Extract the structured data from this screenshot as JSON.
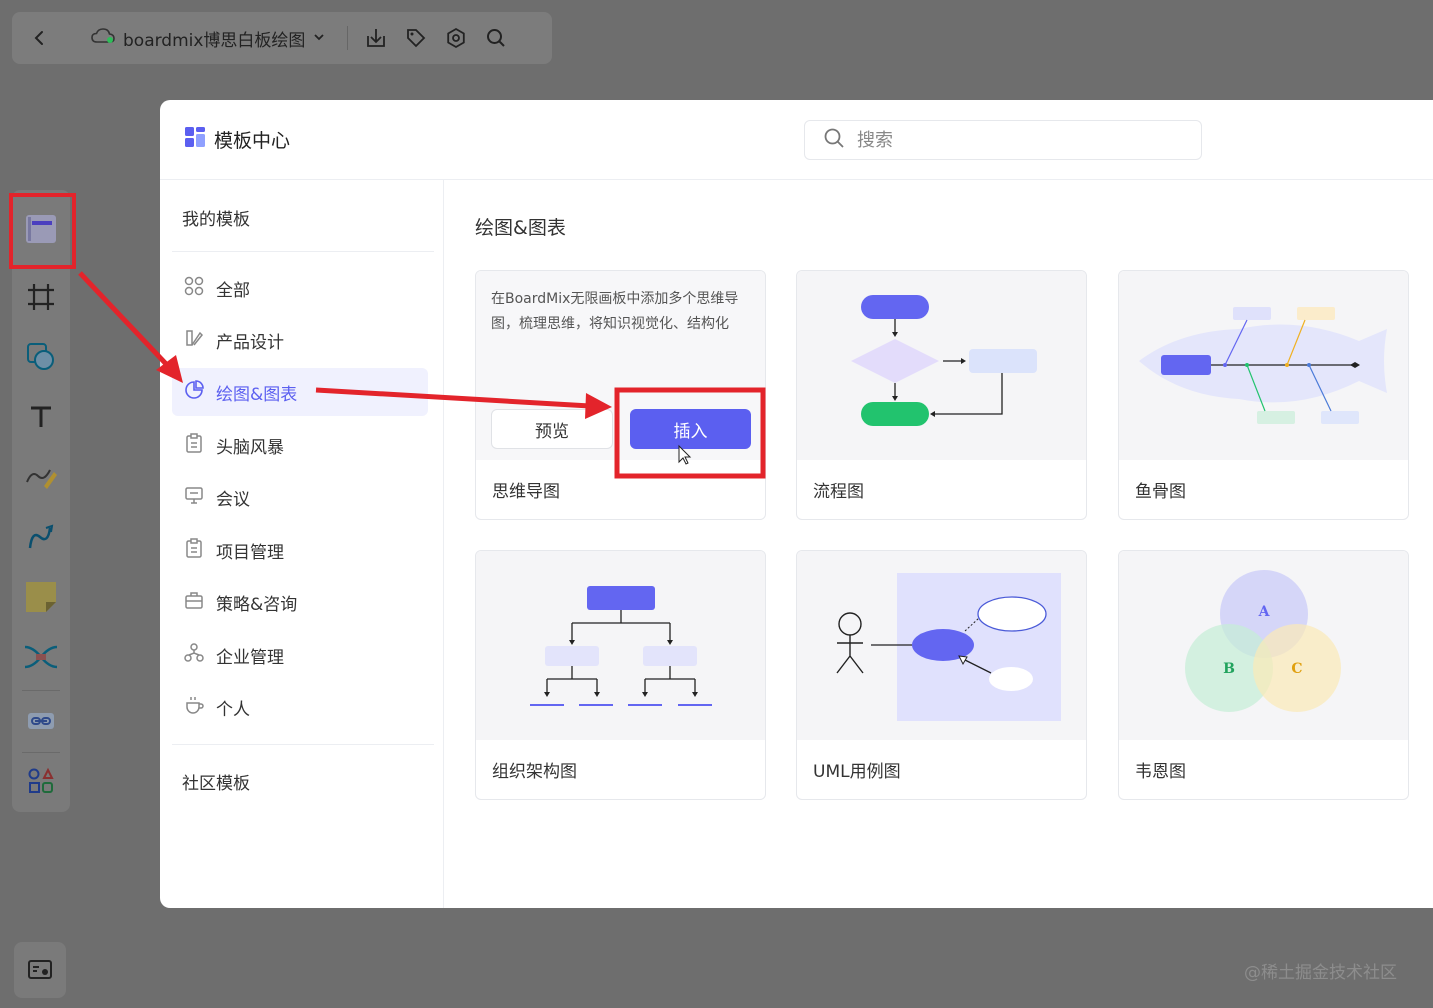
{
  "topbar": {
    "file_name": "boardmix博思白板绘图",
    "icons": [
      "back-icon",
      "cloud-icon",
      "chevron-down-icon",
      "download-icon",
      "tag-icon",
      "settings-icon",
      "search-icon"
    ]
  },
  "rail": {
    "tools": [
      "template-icon",
      "frame-icon",
      "shape-icon",
      "text-icon",
      "pen-icon",
      "connector-icon",
      "sticky-note-icon",
      "mindmap-icon",
      "link-icon",
      "more-tools-icon"
    ]
  },
  "modal": {
    "title": "模板中心",
    "search_placeholder": "搜索"
  },
  "sidebar": {
    "my_templates": "我的模板",
    "items": [
      {
        "label": "全部",
        "icon": "grid-icon"
      },
      {
        "label": "产品设计",
        "icon": "design-icon"
      },
      {
        "label": "绘图&图表",
        "icon": "chart-icon",
        "active": true
      },
      {
        "label": "头脑风暴",
        "icon": "clipboard-icon"
      },
      {
        "label": "会议",
        "icon": "meeting-icon"
      },
      {
        "label": "项目管理",
        "icon": "clipboard-icon"
      },
      {
        "label": "策略&咨询",
        "icon": "briefcase-icon"
      },
      {
        "label": "企业管理",
        "icon": "org-icon"
      },
      {
        "label": "个人",
        "icon": "coffee-icon"
      }
    ],
    "community_templates": "社区模板"
  },
  "content": {
    "section_title": "绘图&图表",
    "cards": [
      {
        "name": "思维导图",
        "description": "在BoardMix无限画板中添加多个思维导图，梳理思维，将知识视觉化、结构化",
        "preview_label": "预览",
        "insert_label": "插入"
      },
      {
        "name": "流程图"
      },
      {
        "name": "鱼骨图"
      },
      {
        "name": "组织架构图"
      },
      {
        "name": "UML用例图"
      },
      {
        "name": "韦恩图",
        "venn_labels": [
          "A",
          "B",
          "C"
        ]
      }
    ]
  },
  "watermark": "@稀土掘金技术社区",
  "colors": {
    "accent": "#5b5ff0",
    "annotation_red": "#e3242b",
    "backdrop": "#6e6e6e"
  }
}
